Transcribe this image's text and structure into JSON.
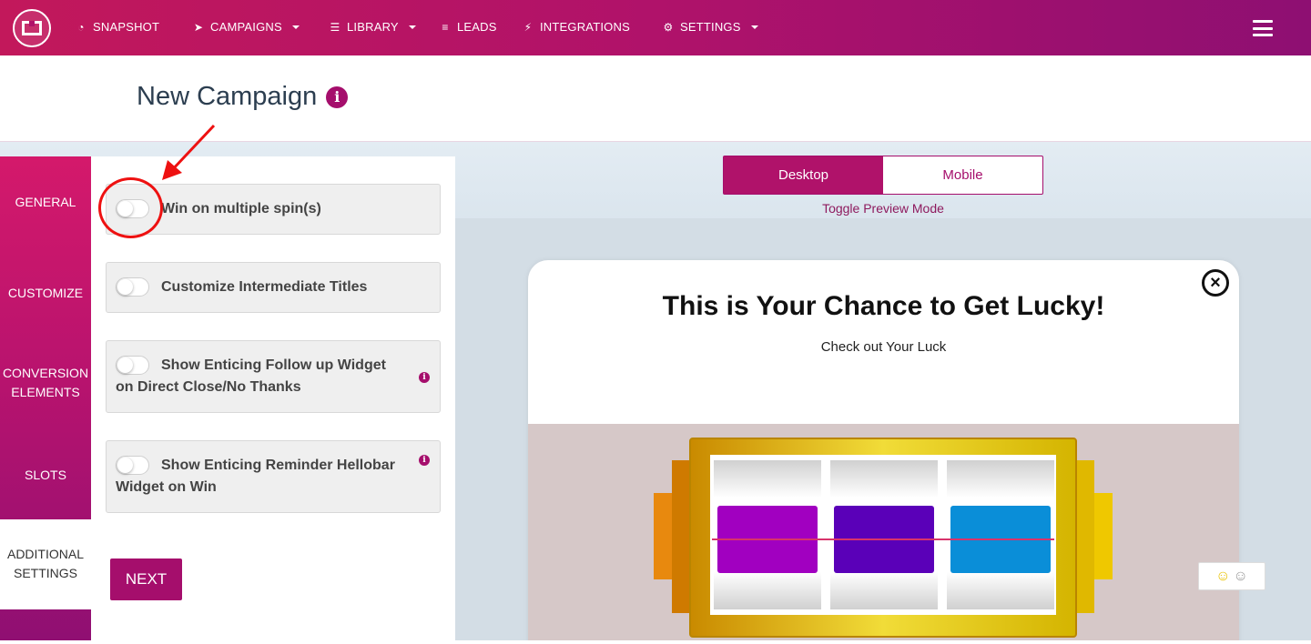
{
  "nav": {
    "items": [
      {
        "label": "SNAPSHOT",
        "icon": "dashboard-icon",
        "dropdown": false
      },
      {
        "label": "CAMPAIGNS",
        "icon": "paper-plane-icon",
        "dropdown": true
      },
      {
        "label": "LIBRARY",
        "icon": "server-icon",
        "dropdown": true
      },
      {
        "label": "LEADS",
        "icon": "list-icon",
        "dropdown": false
      },
      {
        "label": "INTEGRATIONS",
        "icon": "plug-icon",
        "dropdown": false
      },
      {
        "label": "SETTINGS",
        "icon": "gears-icon",
        "dropdown": true
      }
    ]
  },
  "page": {
    "title": "New Campaign",
    "info_glyph": "i"
  },
  "side_tabs": [
    {
      "label": "GENERAL",
      "active": false
    },
    {
      "label": "CUSTOMIZE",
      "active": false
    },
    {
      "label": "CONVERSION ELEMENTS",
      "active": false
    },
    {
      "label": "SLOTS",
      "active": false
    },
    {
      "label": "ADDITIONAL SETTINGS",
      "active": true
    }
  ],
  "settings": {
    "options": [
      {
        "label": "Win on multiple spin(s)",
        "enabled": false
      },
      {
        "label": "Customize Intermediate Titles",
        "enabled": false
      },
      {
        "label": "Show Enticing Follow up Widget on Direct Close/No Thanks",
        "enabled": false,
        "info": true
      },
      {
        "label": "Show Enticing Reminder Hellobar Widget on Win",
        "enabled": false,
        "info": true
      }
    ],
    "next_label": "NEXT"
  },
  "preview": {
    "modes": [
      "Desktop",
      "Mobile"
    ],
    "active_mode": "Desktop",
    "toggle_caption": "Toggle Preview Mode",
    "popup_title": "This is Your Chance to Get Lucky!",
    "popup_subtitle": "Check out Your Luck",
    "close_glyph": "×",
    "reel_colors": [
      "#a100c0",
      "#5a00b8",
      "#0a8ed8"
    ]
  },
  "colors": {
    "brand": "#b0126a",
    "brand_dark": "#8e0f72",
    "annotation": "#ee1111"
  }
}
